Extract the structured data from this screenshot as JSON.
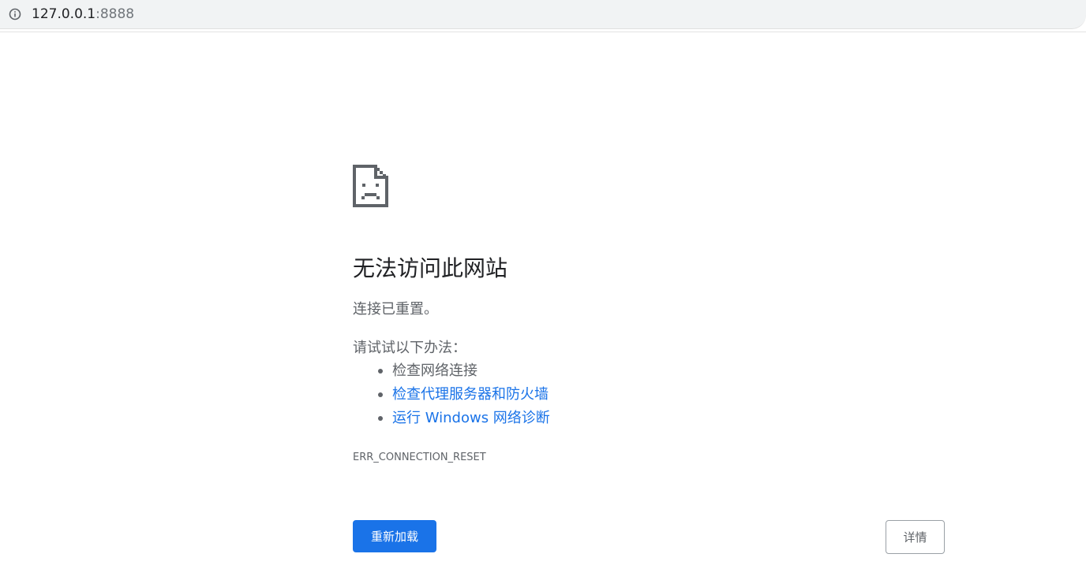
{
  "browser": {
    "url_host": "127.0.0.1",
    "url_port": ":8888",
    "info_icon": "info-icon"
  },
  "error_page": {
    "icon": "sad-page-icon",
    "title": "无法访问此网站",
    "subtitle": "连接已重置。",
    "suggestions_title": "请试试以下办法：",
    "suggestions": [
      {
        "label": "检查网络连接",
        "link": false
      },
      {
        "label": "检查代理服务器和防火墙",
        "link": true
      },
      {
        "label": "运行 Windows 网络诊断",
        "link": true
      }
    ],
    "error_code": "ERR_CONNECTION_RESET",
    "reload_label": "重新加载",
    "details_label": "详情"
  },
  "colors": {
    "accent": "#1a73e8",
    "text_primary": "#202124",
    "text_secondary": "#5f6368"
  }
}
